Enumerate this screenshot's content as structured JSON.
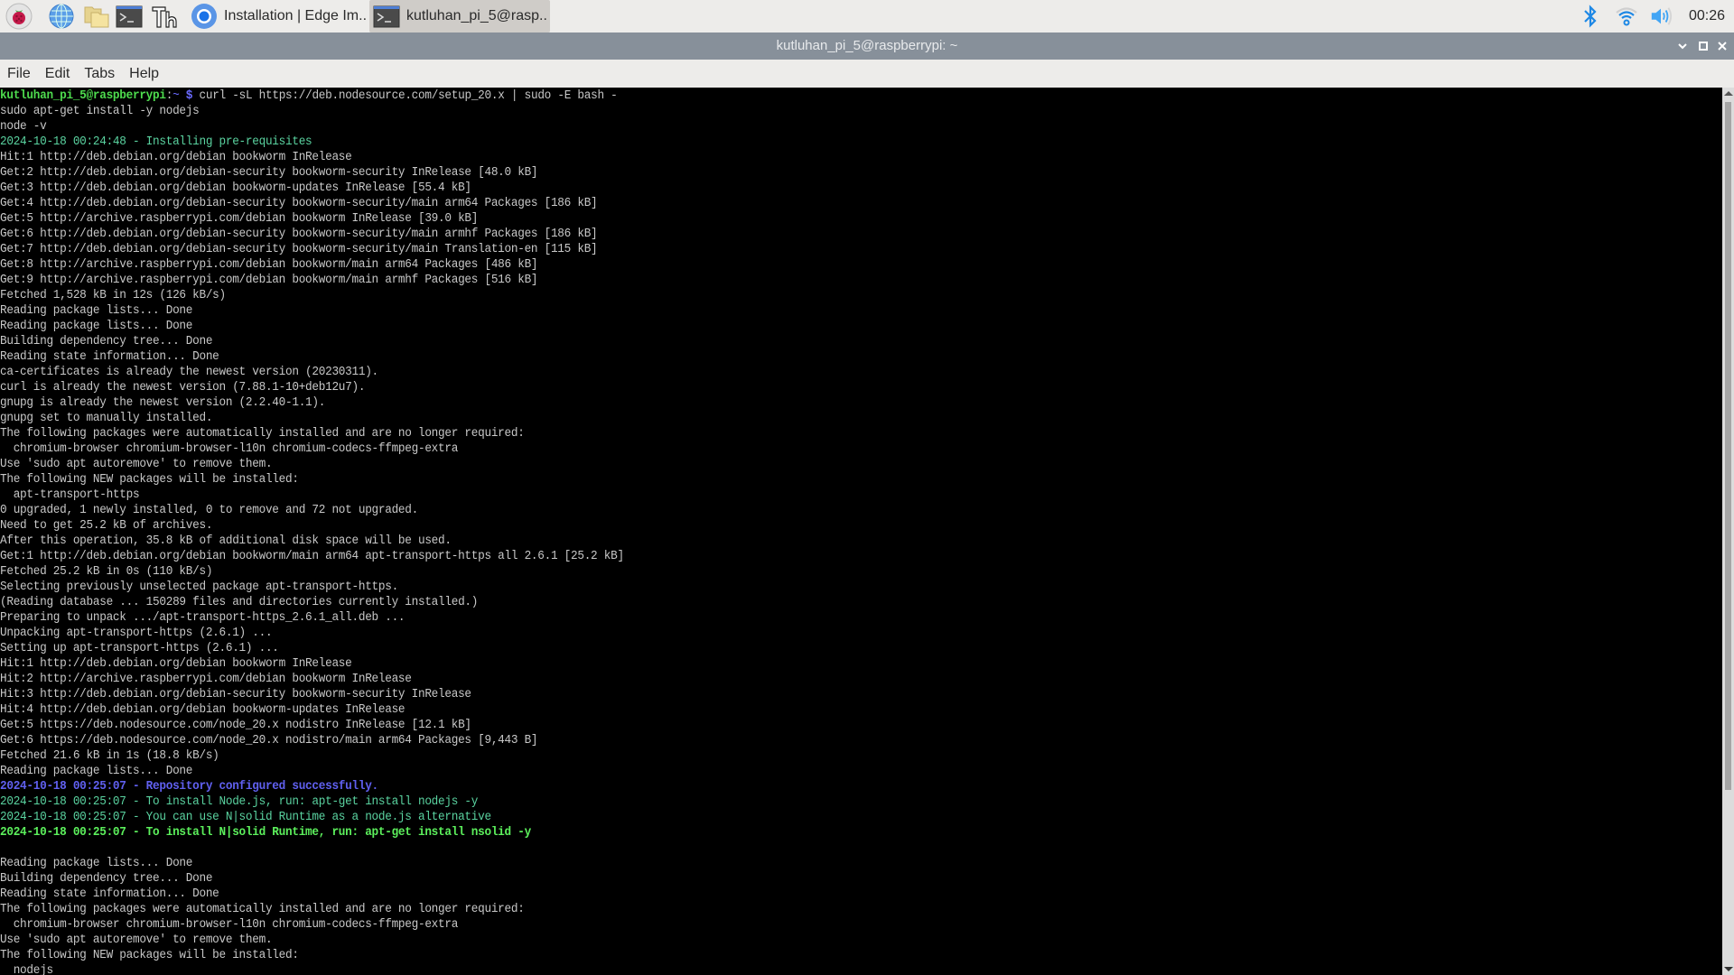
{
  "taskbar": {
    "launchers": [
      {
        "name": "raspberry-menu-icon"
      },
      {
        "name": "web-browser-icon"
      },
      {
        "name": "file-manager-icon"
      },
      {
        "name": "terminal-launcher-icon"
      },
      {
        "name": "thonny-icon"
      }
    ],
    "tasks": [
      {
        "label": "Installation | Edge Im..",
        "icon": "chromium-icon",
        "active": false
      },
      {
        "label": "kutluhan_pi_5@rasp..",
        "icon": "terminal-icon",
        "active": true
      }
    ],
    "tray": {
      "bluetooth": "bluetooth-icon",
      "wifi": "wifi-icon",
      "volume": "volume-icon",
      "clock": "00:26"
    }
  },
  "window": {
    "title": "kutluhan_pi_5@raspberrypi: ~",
    "controls": [
      "minimize",
      "maximize",
      "close"
    ]
  },
  "menubar": {
    "items": [
      "File",
      "Edit",
      "Tabs",
      "Help"
    ]
  },
  "terminal": {
    "prompt": {
      "user_host": "kutluhan_pi_5@raspberrypi",
      "sep": ":",
      "cwd": "~",
      "symbol": " $",
      "command": " curl -sL https://deb.nodesource.com/setup_20.x | sudo -E bash -"
    },
    "lines": [
      {
        "text": "sudo apt-get install -y nodejs",
        "style": ""
      },
      {
        "text": "node -v",
        "style": ""
      },
      {
        "text": "2024-10-18 00:24:48 - Installing pre-requisites",
        "style": "c-cyan"
      },
      {
        "text": "Hit:1 http://deb.debian.org/debian bookworm InRelease",
        "style": ""
      },
      {
        "text": "Get:2 http://deb.debian.org/debian-security bookworm-security InRelease [48.0 kB]",
        "style": ""
      },
      {
        "text": "Get:3 http://deb.debian.org/debian bookworm-updates InRelease [55.4 kB]",
        "style": ""
      },
      {
        "text": "Get:4 http://deb.debian.org/debian-security bookworm-security/main arm64 Packages [186 kB]",
        "style": ""
      },
      {
        "text": "Get:5 http://archive.raspberrypi.com/debian bookworm InRelease [39.0 kB]",
        "style": ""
      },
      {
        "text": "Get:6 http://deb.debian.org/debian-security bookworm-security/main armhf Packages [186 kB]",
        "style": ""
      },
      {
        "text": "Get:7 http://deb.debian.org/debian-security bookworm-security/main Translation-en [115 kB]",
        "style": ""
      },
      {
        "text": "Get:8 http://archive.raspberrypi.com/debian bookworm/main arm64 Packages [486 kB]",
        "style": ""
      },
      {
        "text": "Get:9 http://archive.raspberrypi.com/debian bookworm/main armhf Packages [516 kB]",
        "style": ""
      },
      {
        "text": "Fetched 1,528 kB in 12s (126 kB/s)",
        "style": ""
      },
      {
        "text": "Reading package lists... Done",
        "style": ""
      },
      {
        "text": "Reading package lists... Done",
        "style": ""
      },
      {
        "text": "Building dependency tree... Done",
        "style": ""
      },
      {
        "text": "Reading state information... Done",
        "style": ""
      },
      {
        "text": "ca-certificates is already the newest version (20230311).",
        "style": ""
      },
      {
        "text": "curl is already the newest version (7.88.1-10+deb12u7).",
        "style": ""
      },
      {
        "text": "gnupg is already the newest version (2.2.40-1.1).",
        "style": ""
      },
      {
        "text": "gnupg set to manually installed.",
        "style": ""
      },
      {
        "text": "The following packages were automatically installed and are no longer required:",
        "style": ""
      },
      {
        "text": "  chromium-browser chromium-browser-l10n chromium-codecs-ffmpeg-extra",
        "style": ""
      },
      {
        "text": "Use 'sudo apt autoremove' to remove them.",
        "style": ""
      },
      {
        "text": "The following NEW packages will be installed:",
        "style": ""
      },
      {
        "text": "  apt-transport-https",
        "style": ""
      },
      {
        "text": "0 upgraded, 1 newly installed, 0 to remove and 72 not upgraded.",
        "style": ""
      },
      {
        "text": "Need to get 25.2 kB of archives.",
        "style": ""
      },
      {
        "text": "After this operation, 35.8 kB of additional disk space will be used.",
        "style": ""
      },
      {
        "text": "Get:1 http://deb.debian.org/debian bookworm/main arm64 apt-transport-https all 2.6.1 [25.2 kB]",
        "style": ""
      },
      {
        "text": "Fetched 25.2 kB in 0s (110 kB/s)",
        "style": ""
      },
      {
        "text": "Selecting previously unselected package apt-transport-https.",
        "style": ""
      },
      {
        "text": "(Reading database ... 150289 files and directories currently installed.)",
        "style": ""
      },
      {
        "text": "Preparing to unpack .../apt-transport-https_2.6.1_all.deb ...",
        "style": ""
      },
      {
        "text": "Unpacking apt-transport-https (2.6.1) ...",
        "style": ""
      },
      {
        "text": "Setting up apt-transport-https (2.6.1) ...",
        "style": ""
      },
      {
        "text": "Hit:1 http://deb.debian.org/debian bookworm InRelease",
        "style": ""
      },
      {
        "text": "Hit:2 http://archive.raspberrypi.com/debian bookworm InRelease",
        "style": ""
      },
      {
        "text": "Hit:3 http://deb.debian.org/debian-security bookworm-security InRelease",
        "style": ""
      },
      {
        "text": "Hit:4 http://deb.debian.org/debian bookworm-updates InRelease",
        "style": ""
      },
      {
        "text": "Get:5 https://deb.nodesource.com/node_20.x nodistro InRelease [12.1 kB]",
        "style": ""
      },
      {
        "text": "Get:6 https://deb.nodesource.com/node_20.x nodistro/main arm64 Packages [9,443 B]",
        "style": ""
      },
      {
        "text": "Fetched 21.6 kB in 1s (18.8 kB/s)",
        "style": ""
      },
      {
        "text": "Reading package lists... Done",
        "style": ""
      },
      {
        "text": "2024-10-18 00:25:07 - Repository configured successfully.",
        "style": "c-bluebold"
      },
      {
        "text": "2024-10-18 00:25:07 - To install Node.js, run: apt-get install nodejs -y",
        "style": "c-cyan"
      },
      {
        "text": "2024-10-18 00:25:07 - You can use N|solid Runtime as a node.js alternative",
        "style": "c-cyan"
      },
      {
        "text": "2024-10-18 00:25:07 - To install N|solid Runtime, run: apt-get install nsolid -y",
        "style": "c-greenbold"
      },
      {
        "text": "",
        "style": ""
      },
      {
        "text": "Reading package lists... Done",
        "style": ""
      },
      {
        "text": "Building dependency tree... Done",
        "style": ""
      },
      {
        "text": "Reading state information... Done",
        "style": ""
      },
      {
        "text": "The following packages were automatically installed and are no longer required:",
        "style": ""
      },
      {
        "text": "  chromium-browser chromium-browser-l10n chromium-codecs-ffmpeg-extra",
        "style": ""
      },
      {
        "text": "Use 'sudo apt autoremove' to remove them.",
        "style": ""
      },
      {
        "text": "The following NEW packages will be installed:",
        "style": ""
      },
      {
        "text": "  nodejs",
        "style": ""
      }
    ]
  }
}
